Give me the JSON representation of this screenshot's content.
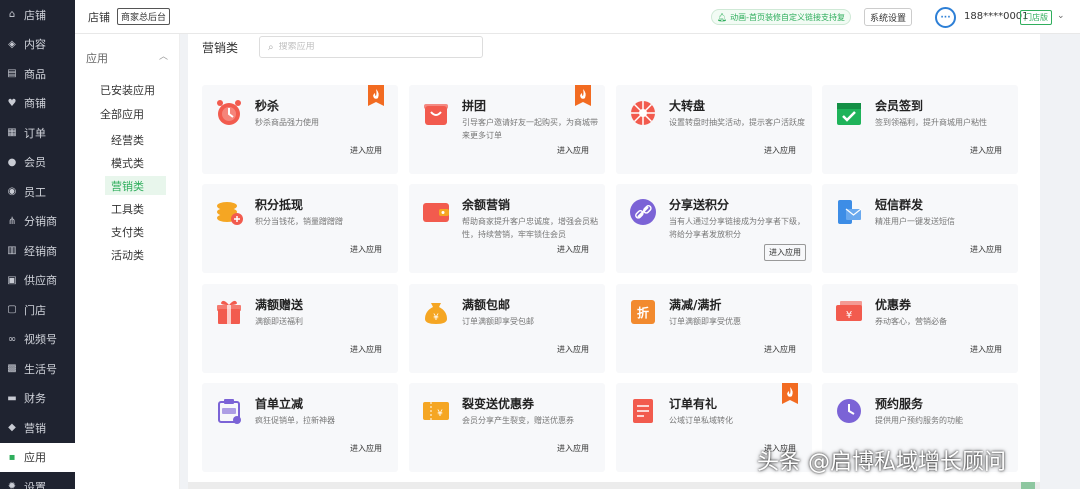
{
  "sidebar": {
    "items": [
      {
        "label": "店铺",
        "icon": "home-icon",
        "glyph": "⌂"
      },
      {
        "label": "内容",
        "icon": "layers-icon",
        "glyph": "◈"
      },
      {
        "label": "商品",
        "icon": "box-icon",
        "glyph": "▤"
      },
      {
        "label": "商铺",
        "icon": "heart-icon",
        "glyph": "♥"
      },
      {
        "label": "订单",
        "icon": "clipboard-icon",
        "glyph": "▦"
      },
      {
        "label": "会员",
        "icon": "user-icon",
        "glyph": "●"
      },
      {
        "label": "员工",
        "icon": "staff-icon",
        "glyph": "◉"
      },
      {
        "label": "分销商",
        "icon": "share-icon",
        "glyph": "⋔"
      },
      {
        "label": "经销商",
        "icon": "building-icon",
        "glyph": "▥"
      },
      {
        "label": "供应商",
        "icon": "truck-icon",
        "glyph": "▣"
      },
      {
        "label": "门店",
        "icon": "store-icon",
        "glyph": "▢"
      },
      {
        "label": "视频号",
        "icon": "video-icon",
        "glyph": "∞"
      },
      {
        "label": "生活号",
        "icon": "life-icon",
        "glyph": "▩"
      },
      {
        "label": "财务",
        "icon": "wallet-icon",
        "glyph": "▬"
      },
      {
        "label": "营销",
        "icon": "tag-icon",
        "glyph": "◆"
      },
      {
        "label": "应用",
        "icon": "apps-grid-icon",
        "glyph": "▪"
      },
      {
        "label": "设置",
        "icon": "gear-icon",
        "glyph": "✹"
      }
    ],
    "active_index": 15
  },
  "topbar": {
    "store_label": "店铺",
    "merchant_tag": "商家总后台",
    "notice": "动画-首页装修自定义链接支持复",
    "system_settings": "系统设置",
    "avatar_glyph": "···",
    "phone": "188****0001",
    "shop_admin_tag": "门店版",
    "chevron": "⌄"
  },
  "subnav": {
    "title": "应用",
    "collapse": "︿",
    "links": [
      "已安装应用",
      "全部应用"
    ],
    "categories": [
      "经营类",
      "模式类",
      "营销类",
      "工具类",
      "支付类",
      "活动类"
    ],
    "active_category": 2
  },
  "main": {
    "section_title": "营销类",
    "search_placeholder": "搜索应用"
  },
  "apps": [
    {
      "name": "秒杀",
      "desc": "秒杀商品强力使用",
      "enter": "进入应用",
      "hot": true,
      "icon": "alarm-clock-icon",
      "color": "#f25b4e"
    },
    {
      "name": "拼团",
      "desc": "引导客户邀请好友一起购买，为商城带来更多订单",
      "enter": "进入应用",
      "hot": true,
      "icon": "shopping-bag-icon",
      "color": "#f25b4e"
    },
    {
      "name": "大转盘",
      "desc": "设置转盘时抽奖活动，提示客户活跃度",
      "enter": "进入应用",
      "hot": false,
      "icon": "wheel-icon",
      "color": "#f25b4e"
    },
    {
      "name": "会员签到",
      "desc": "签到领福利，提升商城用户粘性",
      "enter": "进入应用",
      "hot": false,
      "icon": "calendar-check-icon",
      "color": "#1fb35a"
    },
    {
      "name": "积分抵现",
      "desc": "积分当钱花，销量蹭蹭蹭",
      "enter": "进入应用",
      "hot": false,
      "icon": "coins-icon",
      "color": "#f5a623"
    },
    {
      "name": "余额营销",
      "desc": "帮助商家提升客户忠诚度，增强会员粘性，持续营销，牢牢锁住会员",
      "enter": "进入应用",
      "hot": false,
      "icon": "wallet-icon",
      "color": "#f25b4e"
    },
    {
      "name": "分享送积分",
      "desc": "当有人通过分享链接成为分享者下级，将给分享者发放积分",
      "enter": "进入应用",
      "hot": false,
      "icon": "link-icon",
      "color": "#7b63d6",
      "boxed": true
    },
    {
      "name": "短信群发",
      "desc": "精准用户一键发送短信",
      "enter": "进入应用",
      "hot": false,
      "icon": "sms-icon",
      "color": "#3d8de6"
    },
    {
      "name": "满额赠送",
      "desc": "满额即送福利",
      "enter": "进入应用",
      "hot": false,
      "icon": "gift-icon",
      "color": "#f25b4e"
    },
    {
      "name": "满额包邮",
      "desc": "订单满额即享受包邮",
      "enter": "进入应用",
      "hot": false,
      "icon": "money-bag-icon",
      "color": "#f5a623"
    },
    {
      "name": "满减/满折",
      "desc": "订单满额即享受优惠",
      "enter": "进入应用",
      "hot": false,
      "icon": "discount-icon",
      "color": "#f28a2e"
    },
    {
      "name": "优惠券",
      "desc": "券动客心，营销必备",
      "enter": "进入应用",
      "hot": false,
      "icon": "coupon-icon",
      "color": "#f25b4e"
    },
    {
      "name": "首单立减",
      "desc": "疯狂促销单，拉新神器",
      "enter": "进入应用",
      "hot": false,
      "icon": "first-order-icon",
      "color": "#7b63d6"
    },
    {
      "name": "裂变送优惠券",
      "desc": "会员分享产生裂变，赠送优惠券",
      "enter": "进入应用",
      "hot": false,
      "icon": "ticket-icon",
      "color": "#f5a623"
    },
    {
      "name": "订单有礼",
      "desc": "公域订单私域转化",
      "enter": "进入应用",
      "hot": true,
      "icon": "order-gift-icon",
      "color": "#f25b4e"
    },
    {
      "name": "预约服务",
      "desc": "提供用户预约服务的功能",
      "enter": "",
      "hot": false,
      "icon": "appointment-icon",
      "color": "#7b63d6"
    }
  ],
  "colors": {
    "brand_green": "#2fae5c",
    "sidebar_bg": "#1f2330",
    "hot_orange": "#f26b21"
  },
  "watermark": "头条 @启博私域增长顾问"
}
